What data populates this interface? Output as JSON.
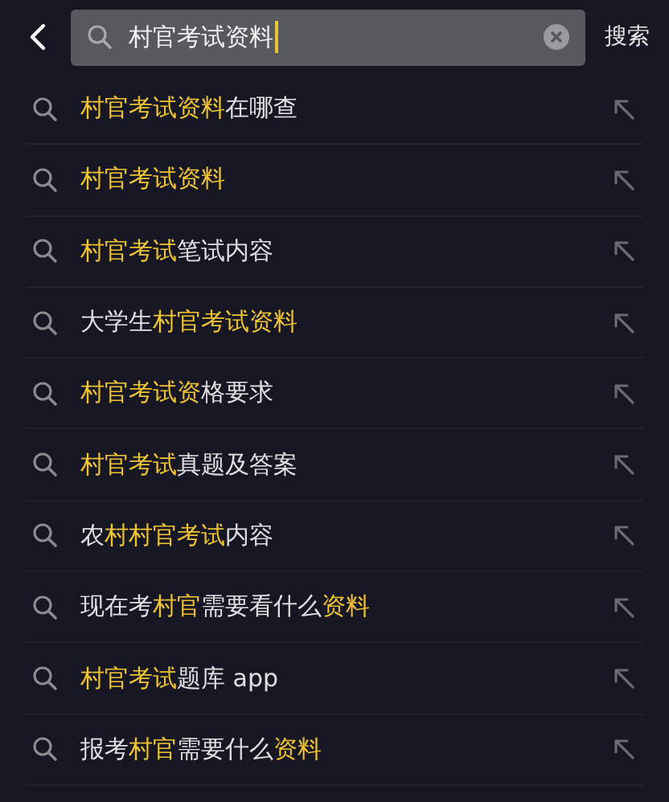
{
  "search_bar": {
    "value": "村官考试资料",
    "button": "搜索"
  },
  "suggestions": [
    {
      "segments": [
        {
          "text": "村官考试资料",
          "highlight": true
        },
        {
          "text": "在哪查",
          "highlight": false
        }
      ]
    },
    {
      "segments": [
        {
          "text": "村官考试资料",
          "highlight": true
        }
      ]
    },
    {
      "segments": [
        {
          "text": "村官考试",
          "highlight": true
        },
        {
          "text": "笔试内容",
          "highlight": false
        }
      ]
    },
    {
      "segments": [
        {
          "text": "大学生",
          "highlight": false
        },
        {
          "text": "村官考试资料",
          "highlight": true
        }
      ]
    },
    {
      "segments": [
        {
          "text": "村官考试资",
          "highlight": true
        },
        {
          "text": "格要求",
          "highlight": false
        }
      ]
    },
    {
      "segments": [
        {
          "text": "村官考试",
          "highlight": true
        },
        {
          "text": "真题及答案",
          "highlight": false
        }
      ]
    },
    {
      "segments": [
        {
          "text": "农",
          "highlight": false
        },
        {
          "text": "村村官考试",
          "highlight": true
        },
        {
          "text": "内容",
          "highlight": false
        }
      ]
    },
    {
      "segments": [
        {
          "text": "现在考",
          "highlight": false
        },
        {
          "text": "村官",
          "highlight": true
        },
        {
          "text": "需要看什么",
          "highlight": false
        },
        {
          "text": "资料",
          "highlight": true
        }
      ]
    },
    {
      "segments": [
        {
          "text": "村官考试",
          "highlight": true
        },
        {
          "text": "题库 app",
          "highlight": false
        }
      ]
    },
    {
      "segments": [
        {
          "text": "报考",
          "highlight": false
        },
        {
          "text": "村官",
          "highlight": true
        },
        {
          "text": "需要什么",
          "highlight": false
        },
        {
          "text": "资料",
          "highlight": true
        }
      ]
    }
  ]
}
